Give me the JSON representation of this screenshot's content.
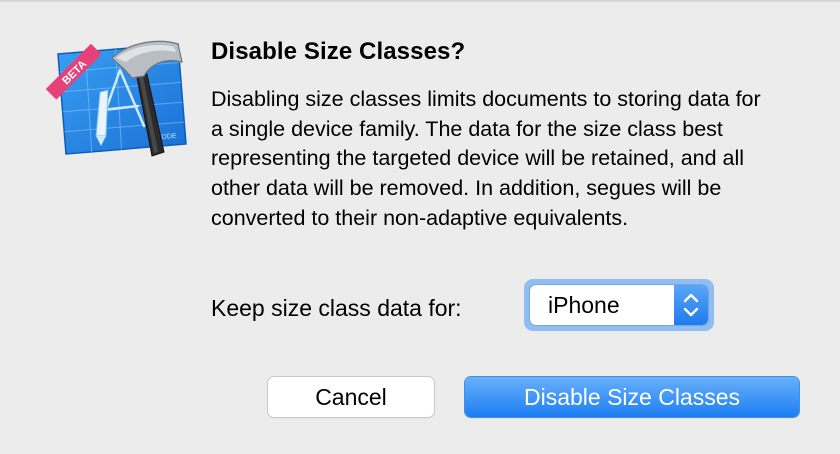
{
  "dialog": {
    "title": "Disable Size Classes?",
    "message": "Disabling size classes limits documents to storing data for a single device family. The data for the size class best representing the targeted device will be retained, and all other data will be removed. In addition, segues will be converted to their non-adaptive equivalents.",
    "icon": {
      "name": "xcode-beta-app-icon",
      "badge_text": "BETA",
      "caption_text": "XCODE"
    }
  },
  "keep_setting": {
    "label": "Keep size class data for:",
    "selected_value": "iPhone"
  },
  "buttons": {
    "cancel_label": "Cancel",
    "confirm_label": "Disable Size Classes"
  },
  "colors": {
    "accent": "#1c7ef3",
    "focus_ring": "#8fbdf4",
    "background": "#ececec"
  }
}
